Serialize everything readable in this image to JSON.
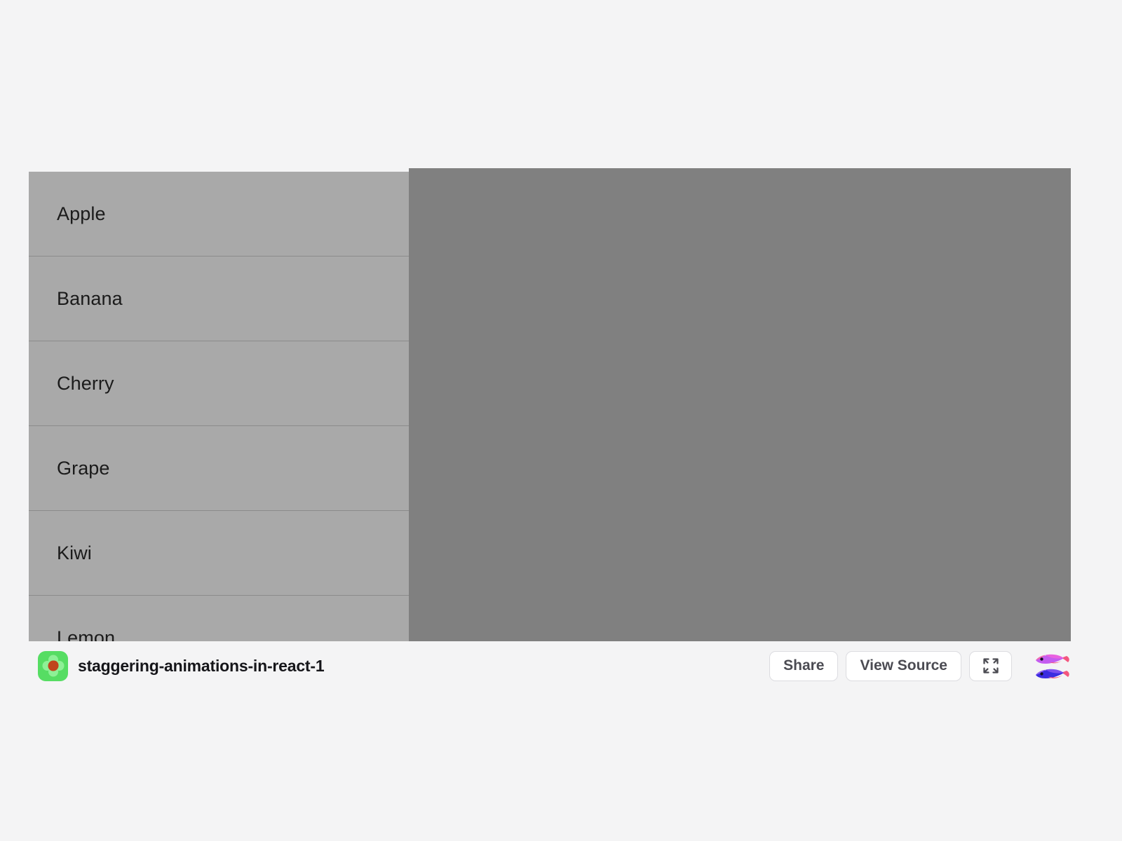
{
  "page": {
    "background_color": "#f4f4f5"
  },
  "sandbox": {
    "title": "staggering-animations-in-react-1",
    "icon_name": "codesandbox-app-icon",
    "icon_colors": {
      "frame": "#56dd63",
      "petals": "#8ef096",
      "core": "#c0451c"
    },
    "preview_background": "#808080"
  },
  "demo_app": {
    "background_color": "#f4f4f5",
    "list_item_background": "#a9a9a9",
    "list_item_divider": "#8b8b8b",
    "list_text_color": "#1b1b1b",
    "items": [
      {
        "label": "Apple"
      },
      {
        "label": "Banana"
      },
      {
        "label": "Cherry"
      },
      {
        "label": "Grape"
      },
      {
        "label": "Kiwi"
      },
      {
        "label": "Lemon"
      }
    ]
  },
  "footer": {
    "share_label": "Share",
    "view_source_label": "View Source",
    "fullscreen_icon_name": "fullscreen-expand-icon",
    "avatar_icon_name": "two-fish-avatar",
    "button_background": "#ffffff",
    "button_border": "#dcdce0",
    "button_text_color": "#4b4b52"
  }
}
